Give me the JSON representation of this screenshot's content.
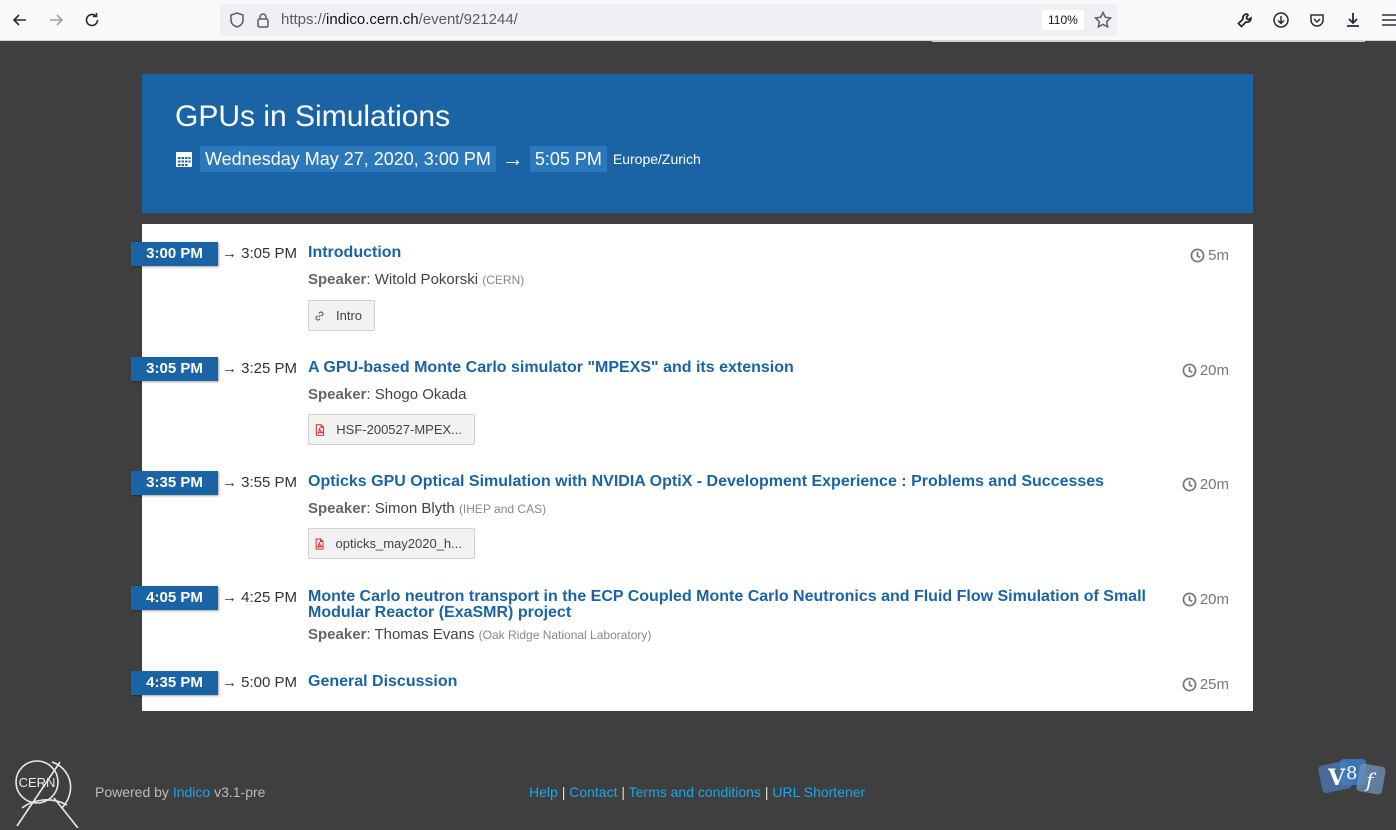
{
  "browser": {
    "url_prefix": "https://",
    "url_domain": "indico.cern.ch",
    "url_path": "/event/921244/",
    "zoom": "110%"
  },
  "event": {
    "title": "GPUs in Simulations",
    "start": "Wednesday May 27, 2020, 3:00 PM",
    "arrow": "→",
    "end": "5:05 PM",
    "timezone": "Europe/Zurich"
  },
  "entries": [
    {
      "start": "3:00 PM",
      "end": "→ 3:05 PM",
      "title": "Introduction",
      "speaker_label": "Speaker",
      "speaker": "Witold Pokorski",
      "affiliation": "(CERN)",
      "duration": "5m",
      "material": "Intro",
      "material_icon": "link-icon"
    },
    {
      "start": "3:05 PM",
      "end": "→ 3:25 PM",
      "title": "A GPU-based Monte Carlo simulator \"MPEXS\" and its extension",
      "speaker_label": "Speaker",
      "speaker": "Shogo Okada",
      "affiliation": "",
      "duration": "20m",
      "material": "HSF-200527-MPEX...",
      "material_icon": "pdf-icon"
    },
    {
      "start": "3:35 PM",
      "end": "→ 3:55 PM",
      "title": "Opticks GPU Optical Simulation with NVIDIA OptiX - Development Experience : Problems and Successes",
      "speaker_label": "Speaker",
      "speaker": "Simon Blyth",
      "affiliation": "(IHEP and CAS)",
      "duration": "20m",
      "material": "opticks_may2020_h...",
      "material_icon": "pdf-icon"
    },
    {
      "start": "4:05 PM",
      "end": "→ 4:25 PM",
      "title": "Monte Carlo neutron transport in the ECP Coupled Monte Carlo Neutronics and Fluid Flow Simulation of Small Modular Reactor (ExaSMR) project",
      "speaker_label": "Speaker",
      "speaker": "Thomas Evans",
      "affiliation": "(Oak Ridge National Laboratory)",
      "duration": "20m"
    },
    {
      "start": "4:35 PM",
      "end": "→ 5:00 PM",
      "title": "General Discussion",
      "duration": "25m"
    }
  ],
  "footer": {
    "powered_prefix": "Powered by",
    "indico": "Indico",
    "version": "v3.1-pre",
    "help": "Help",
    "contact": "Contact",
    "terms": "Terms and conditions",
    "shortener": "URL Shortener",
    "sep": "|",
    "cern_logo_text": "CERN"
  },
  "colors": {
    "accent": "#1a64a6",
    "link": "#1ea5e8",
    "background": "#3f3f3f"
  }
}
